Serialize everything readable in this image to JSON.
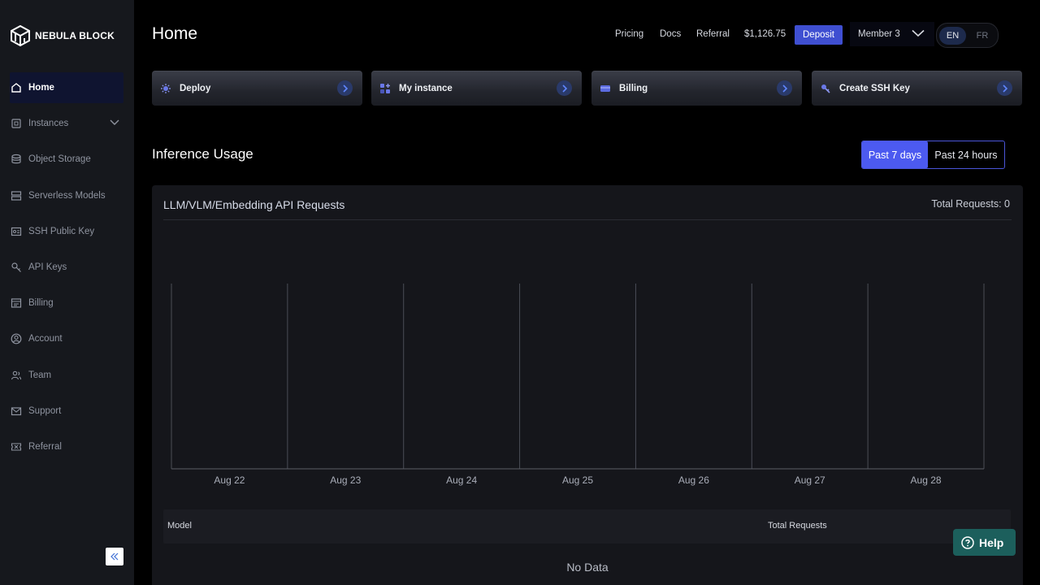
{
  "brand": {
    "name": "NEBULA BLOCK"
  },
  "sidebar": {
    "items": [
      {
        "label": "Home",
        "icon": "home-icon",
        "active": true
      },
      {
        "label": "Instances",
        "icon": "cpu-icon",
        "expandable": true
      },
      {
        "label": "Object Storage",
        "icon": "database-icon"
      },
      {
        "label": "Serverless Models",
        "icon": "server-icon"
      },
      {
        "label": "SSH Public Key",
        "icon": "key-card-icon"
      },
      {
        "label": "API Keys",
        "icon": "key-icon"
      },
      {
        "label": "Billing",
        "icon": "billing-icon"
      },
      {
        "label": "Account",
        "icon": "account-icon"
      },
      {
        "label": "Team",
        "icon": "team-icon"
      },
      {
        "label": "Support",
        "icon": "mail-icon"
      },
      {
        "label": "Referral",
        "icon": "ticket-icon"
      }
    ]
  },
  "header": {
    "title": "Home",
    "links": [
      "Pricing",
      "Docs",
      "Referral"
    ],
    "balance": "$1,126.75",
    "deposit_label": "Deposit",
    "member": "Member 3",
    "lang_en": "EN",
    "lang_fr": "FR"
  },
  "quick_cards": [
    {
      "label": "Deploy",
      "icon": "deploy-icon"
    },
    {
      "label": "My instance",
      "icon": "instance-icon"
    },
    {
      "label": "Billing",
      "icon": "card-icon"
    },
    {
      "label": "Create SSH Key",
      "icon": "ssh-key-icon"
    }
  ],
  "usage": {
    "title": "Inference Usage",
    "range_7d": "Past 7 days",
    "range_24h": "Past 24 hours",
    "panel_title": "LLM/VLM/Embedding API Requests",
    "total_requests": "Total Requests: 0",
    "table_model": "Model",
    "table_total": "Total Requests",
    "no_data": "No Data"
  },
  "chart_data": {
    "type": "bar",
    "categories": [
      "Aug 22",
      "Aug 23",
      "Aug 24",
      "Aug 25",
      "Aug 26",
      "Aug 27",
      "Aug 28"
    ],
    "values": [
      0,
      0,
      0,
      0,
      0,
      0,
      0
    ],
    "title": "LLM/VLM/Embedding API Requests",
    "xlabel": "",
    "ylabel": "",
    "grid": true
  },
  "help": {
    "label": "Help"
  },
  "colors": {
    "accent": "#4c5af0",
    "deposit": "#3f4fd1",
    "help": "#1c5f5c"
  }
}
